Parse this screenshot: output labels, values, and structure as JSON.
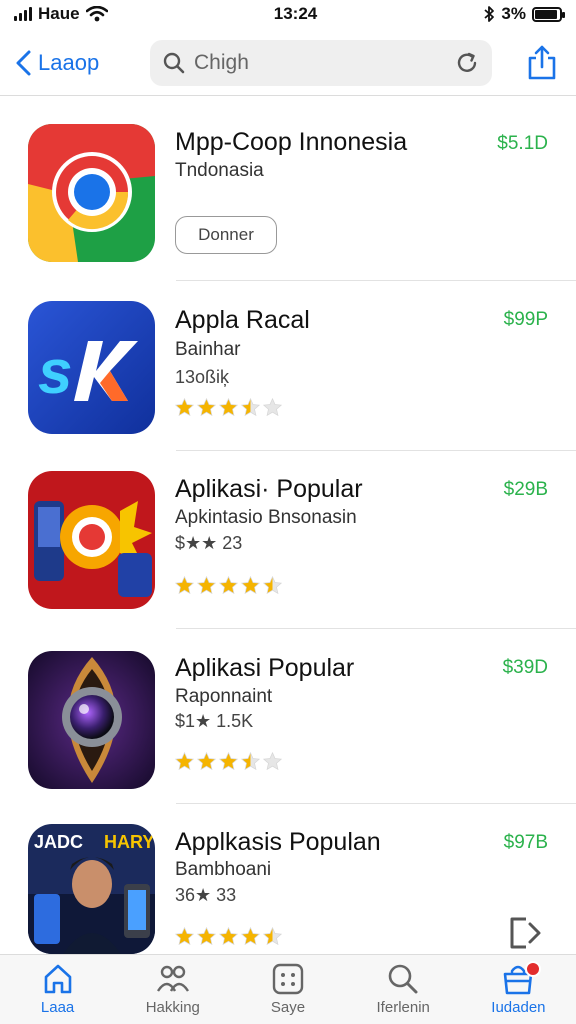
{
  "status_bar": {
    "carrier": "Haue",
    "time": "13:24",
    "battery": "3%",
    "battery_level": 0.9
  },
  "nav": {
    "back_label": "Laaop",
    "search_text": "Chigh"
  },
  "apps": [
    {
      "name": "Mpp-Coop Innonesia",
      "subtitle": "Tndonasia",
      "price": "$5.1D",
      "button": "Donner",
      "icon": "chrome-like-icon"
    },
    {
      "name": "Appla Racal",
      "subtitle": "Bainhar",
      "meta": "13oßiķ",
      "price": "$99P",
      "rating": 3.5,
      "icon": "sk-icon"
    },
    {
      "name": "Aplikasi· Popular",
      "subtitle": "Apkintasio  Bnsonasin",
      "meta": "$★★ 23",
      "price": "$29B",
      "rating": 4.5,
      "icon": "game-icon"
    },
    {
      "name": "Aplikasi  Popular",
      "subtitle": "Raponnaint",
      "meta": "$1★ 1.5K",
      "price": "$39D",
      "rating": 3.5,
      "icon": "camera-lens-icon"
    },
    {
      "name": "Applkasis Populan",
      "subtitle": "Bambhoani",
      "meta": "36★ 33",
      "price": "$97B",
      "rating": 4.5,
      "icon": "poster-icon",
      "poster_text_left": "JADC",
      "poster_text_right": "HARY"
    }
  ],
  "tabs": [
    {
      "label": "Laaa",
      "icon": "home-icon",
      "active": true
    },
    {
      "label": "Hakking",
      "icon": "people-icon",
      "active": false
    },
    {
      "label": "Saye",
      "icon": "grid-icon",
      "active": false
    },
    {
      "label": "Iferlenin",
      "icon": "search-icon",
      "active": false
    },
    {
      "label": "Iudaden",
      "icon": "bag-icon",
      "active": true,
      "badge": true
    }
  ],
  "colors": {
    "accent": "#1a73e8",
    "price": "#2bb24c",
    "star": "#f5b400",
    "badge": "#e32d2d"
  }
}
